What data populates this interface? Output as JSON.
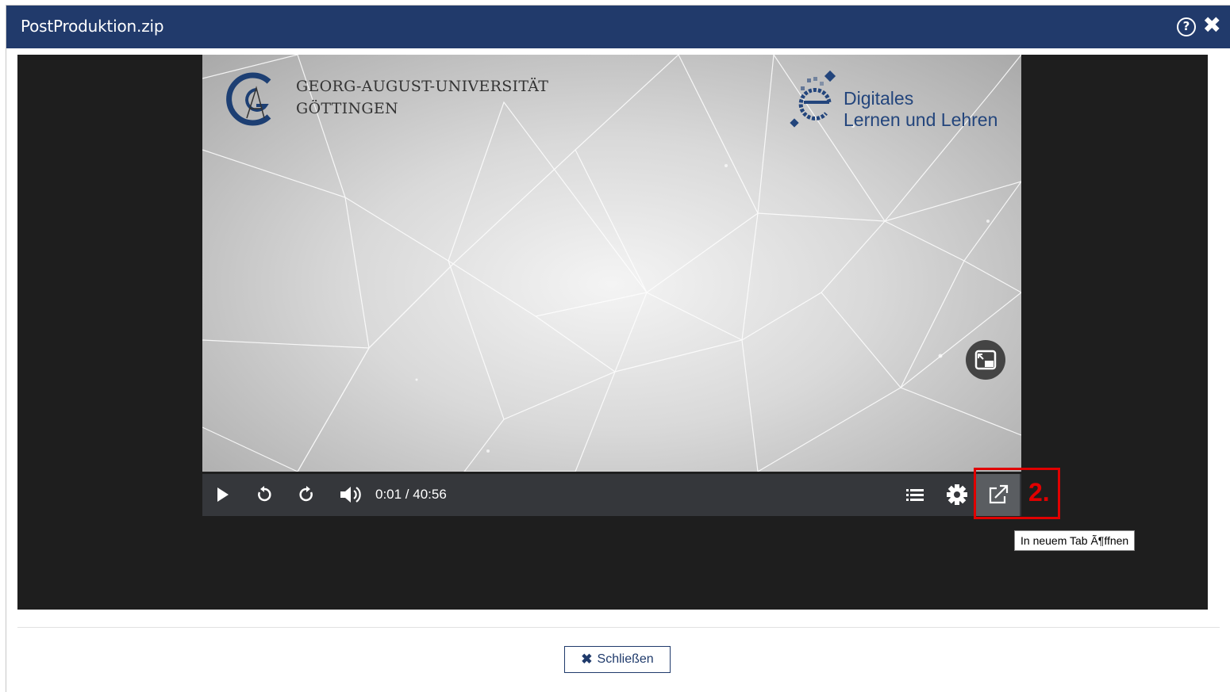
{
  "dialog": {
    "title": "PostProduktion.zip",
    "help_label": "?",
    "close_label": "✖"
  },
  "video": {
    "university_line1": "GEORG-AUGUST-UNIVERSITÄT",
    "university_line2": "GÖTTINGEN",
    "brand_line1": "Digitales",
    "brand_line2": "Lernen und Lehren"
  },
  "player": {
    "time": "0:01 / 40:56",
    "progress_fraction": 0.0004,
    "tooltip": "In neuem Tab Ã¶ffnen"
  },
  "annotation": {
    "step_label": "2.",
    "color": "#e00000"
  },
  "footer": {
    "close_button_label": "Schließen",
    "close_icon": "✖"
  },
  "colors": {
    "titlebar": "#213a6b",
    "player_bg": "#1e1e1e",
    "controls_bg": "#35373b"
  }
}
